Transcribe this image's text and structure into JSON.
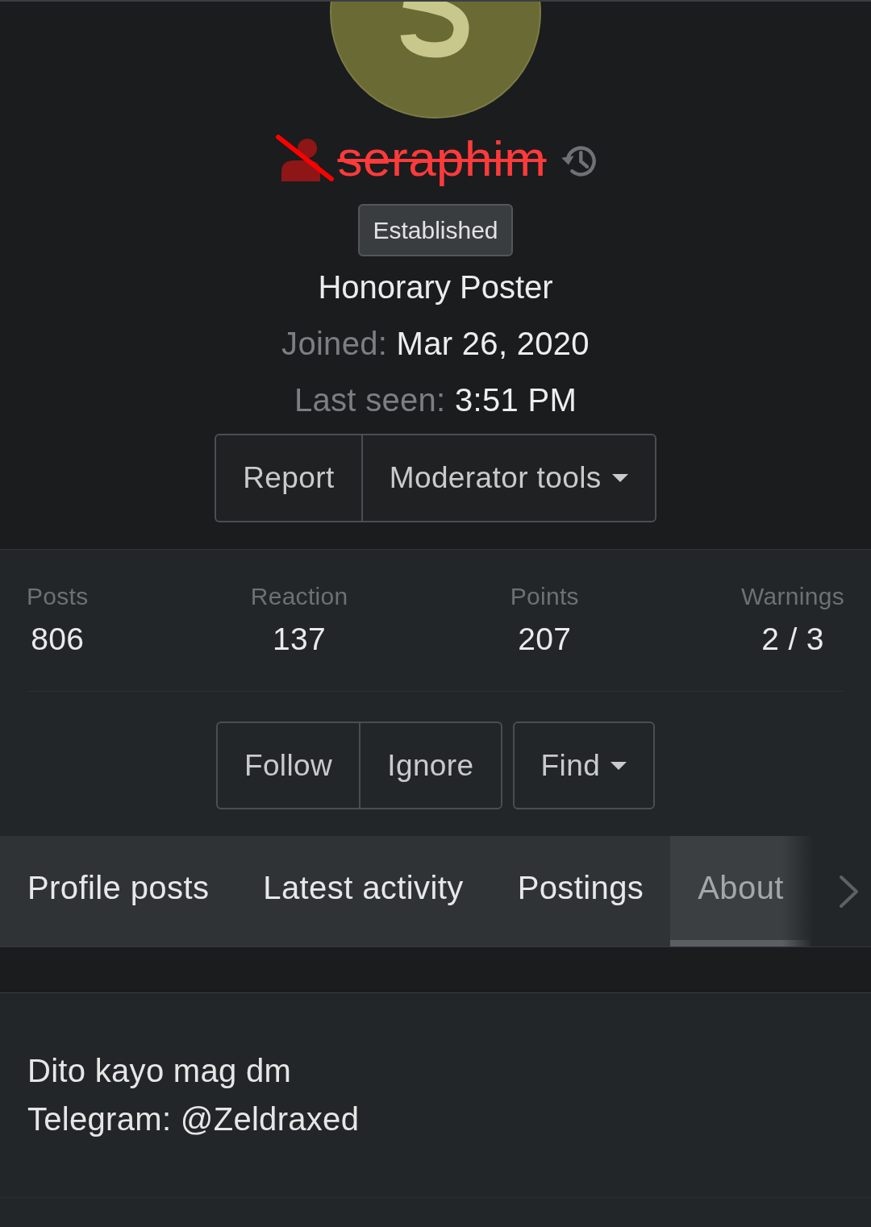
{
  "username": {
    "text": "seraphim",
    "banned": true
  },
  "banner": "Established",
  "user_title": "Honorary Poster",
  "info": [
    {
      "label": "Joined:",
      "value": "Mar 26, 2020"
    },
    {
      "label": "Last seen:",
      "value": "3:51 PM"
    }
  ],
  "profile_actions": [
    {
      "buttons": [
        {
          "label": "Report",
          "kind": "button"
        },
        {
          "label": "Moderator tools",
          "kind": "menu"
        }
      ]
    }
  ],
  "stats": [
    {
      "label": "Posts",
      "value": "806"
    },
    {
      "label": "Reaction",
      "value": "137"
    },
    {
      "label": "Points",
      "value": "207"
    },
    {
      "label": "Warnings",
      "value": "2 / 3"
    }
  ],
  "member_actions": [
    {
      "buttons": [
        {
          "label": "Follow",
          "kind": "button"
        },
        {
          "label": "Ignore",
          "kind": "button"
        }
      ]
    },
    {
      "buttons": [
        {
          "label": "Find",
          "kind": "menu"
        }
      ]
    }
  ],
  "tabs": [
    {
      "label": "Profile posts",
      "selected": false
    },
    {
      "label": "Latest activity",
      "selected": false
    },
    {
      "label": "Postings",
      "selected": false
    },
    {
      "label": "About",
      "selected": true
    }
  ],
  "about": {
    "lines": [
      "Dito kayo mag dm",
      "Telegram: @Zeldraxed"
    ]
  }
}
